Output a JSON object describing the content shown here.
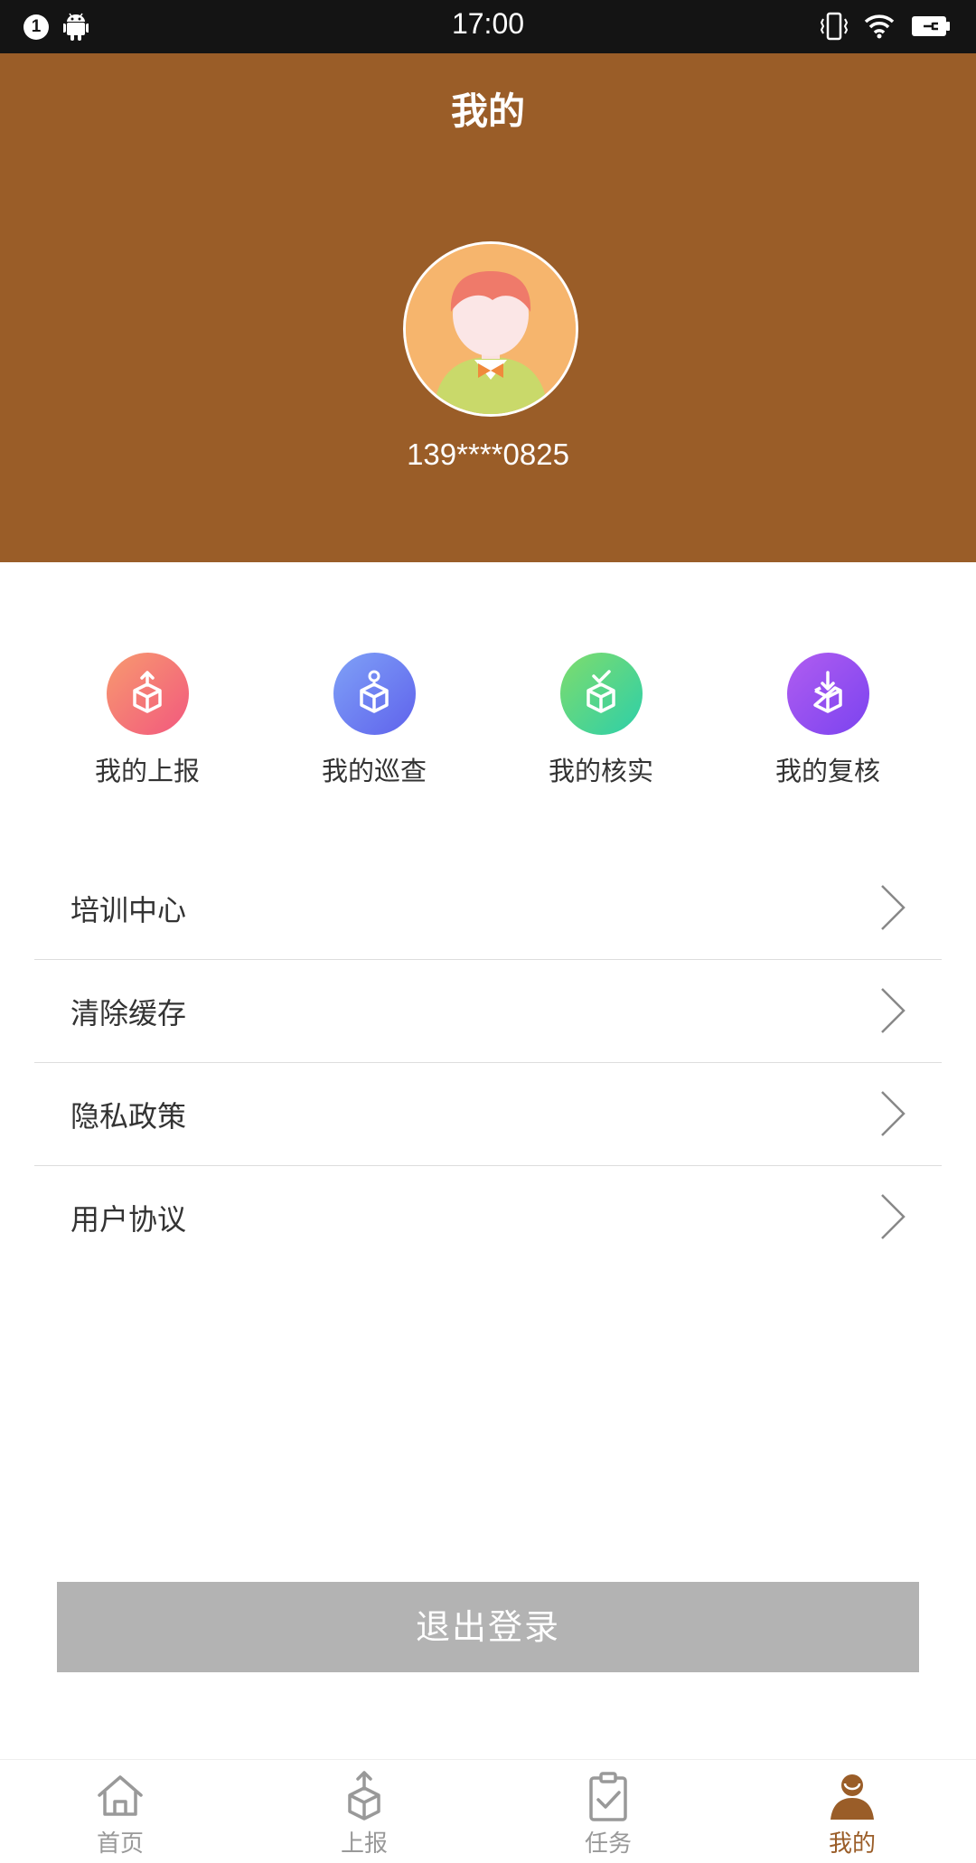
{
  "status_bar": {
    "notification_count": "1",
    "time": "17:00",
    "icons": [
      "android-icon",
      "vibrate-icon",
      "wifi-icon",
      "battery-charging-icon"
    ]
  },
  "header": {
    "title": "我的",
    "phone": "139****0825",
    "background_color": "#9a5d28"
  },
  "shortcuts": [
    {
      "label": "我的上报",
      "icon": "upload-box-icon",
      "color": "#f4697a"
    },
    {
      "label": "我的巡查",
      "icon": "inspect-box-icon",
      "color": "#6f84f2"
    },
    {
      "label": "我的核实",
      "icon": "verify-box-icon",
      "color": "#3ed69a"
    },
    {
      "label": "我的复核",
      "icon": "recheck-box-icon",
      "color": "#9a4ff0"
    }
  ],
  "menu": [
    {
      "label": "培训中心"
    },
    {
      "label": "清除缓存"
    },
    {
      "label": "隐私政策"
    },
    {
      "label": "用户协议"
    }
  ],
  "logout_label": "退出登录",
  "tabbar": [
    {
      "label": "首页",
      "icon": "home-icon",
      "active": false
    },
    {
      "label": "上报",
      "icon": "report-icon",
      "active": false
    },
    {
      "label": "任务",
      "icon": "task-icon",
      "active": false
    },
    {
      "label": "我的",
      "icon": "profile-icon",
      "active": true
    }
  ],
  "colors": {
    "accent": "#9a5d28",
    "logout_bg": "#b3b3b3",
    "tab_inactive": "#999999"
  }
}
